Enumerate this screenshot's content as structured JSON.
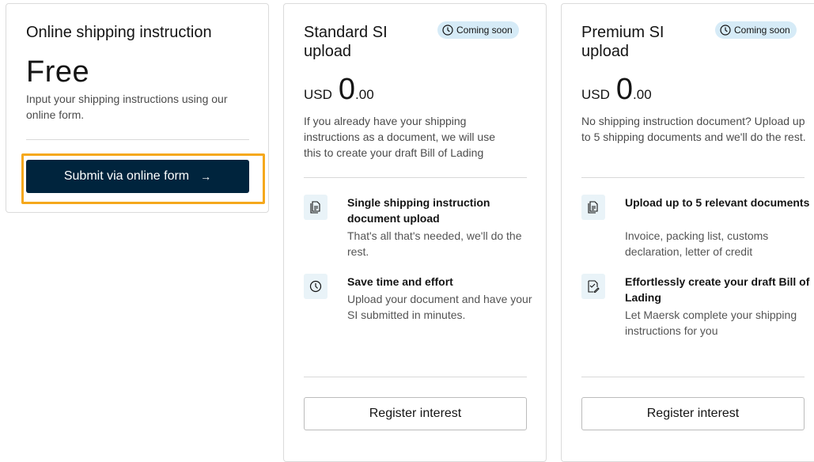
{
  "online": {
    "title": "Online shipping instruction",
    "price": "Free",
    "description": "Input your shipping instructions using our online form.",
    "button_label": "Submit via online form",
    "button_arrow": "→"
  },
  "standard": {
    "title": "Standard SI upload",
    "badge": "Coming soon",
    "currency": "USD",
    "price_main": "0",
    "price_cents": ".00",
    "description": "If you already have your shipping instructions as a document, we will use this to create your draft Bill of Lading",
    "features": [
      {
        "title": "Single shipping instruction document upload",
        "text": "That's all that's needed, we'll do the rest.",
        "icon": "document-upload-icon"
      },
      {
        "title": "Save time and effort",
        "text": "Upload your document and have your SI submitted in minutes.",
        "icon": "clock-icon"
      }
    ],
    "button_label": "Register interest"
  },
  "premium": {
    "title": "Premium SI upload",
    "badge": "Coming soon",
    "currency": "USD",
    "price_main": "0",
    "price_cents": ".00",
    "description": "No shipping instruction document? Upload up to 5 shipping documents and we'll do the rest.",
    "features": [
      {
        "title": "Upload up to 5 relevant documents",
        "text": "Invoice, packing list, customs declaration, letter of credit",
        "icon": "documents-icon"
      },
      {
        "title": "Effortlessly create your draft Bill of Lading",
        "text": "Let Maersk complete your shipping instructions for you",
        "icon": "document-edit-icon"
      }
    ],
    "button_label": "Register interest"
  },
  "colors": {
    "primary": "#00243d",
    "highlight": "#f5a81c",
    "badge_bg": "#d6ebf7",
    "icon_bg": "#e9f3f8"
  }
}
